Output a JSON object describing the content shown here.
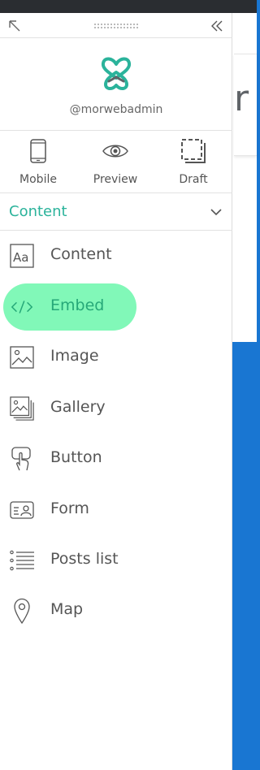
{
  "panel": {
    "username": "@morwebadmin",
    "modes": [
      {
        "label": "Mobile",
        "icon": "mobile-icon"
      },
      {
        "label": "Preview",
        "icon": "eye-icon"
      },
      {
        "label": "Draft",
        "icon": "draft-icon"
      }
    ],
    "section": {
      "title": "Content",
      "expanded": true
    },
    "items": [
      {
        "label": "Content",
        "icon": "text-aa-icon",
        "active": false
      },
      {
        "label": "Embed",
        "icon": "code-icon",
        "active": true
      },
      {
        "label": "Image",
        "icon": "image-icon",
        "active": false
      },
      {
        "label": "Gallery",
        "icon": "gallery-icon",
        "active": false
      },
      {
        "label": "Button",
        "icon": "pointer-hand-icon",
        "active": false
      },
      {
        "label": "Form",
        "icon": "form-icon",
        "active": false
      },
      {
        "label": "Posts list",
        "icon": "list-icon",
        "active": false
      },
      {
        "label": "Map",
        "icon": "map-pin-icon",
        "active": false
      }
    ]
  },
  "background": {
    "logo_fragment": "r"
  },
  "colors": {
    "accent": "#2bb39b",
    "active_item_bg": "#81f8b8",
    "page_blue": "#1976d2",
    "topbar": "#2a2d31"
  }
}
